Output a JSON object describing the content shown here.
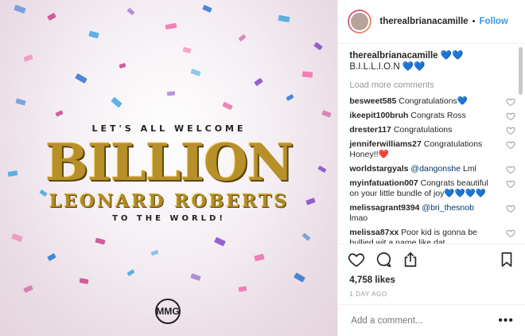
{
  "post": {
    "image": {
      "line_top": "LET'S ALL WELCOME",
      "line_big": "BILLION",
      "line_name": "LEONARD ROBERTS",
      "line_bottom": "TO THE WORLD!",
      "logo_text": "MMG"
    }
  },
  "header": {
    "username": "therealbrianacamille",
    "dot": "•",
    "follow_label": "Follow"
  },
  "caption": {
    "username": "therealbrianacamille",
    "text": " 💙💙 B.I.L.L.I.O.N 💙💙"
  },
  "load_more_label": "Load more comments",
  "comments": [
    {
      "user": "besweet585",
      "text": " Congratulations💙"
    },
    {
      "user": "ikeepit100bruh",
      "text": " Congrats Ross"
    },
    {
      "user": "drester117",
      "text": " Congratulations"
    },
    {
      "user": "jenniferwilliams27",
      "text": " Congratulations Honey!!❤️"
    },
    {
      "user": "worldstargyals",
      "mention": "@dangonshe",
      "text": " Lml"
    },
    {
      "user": "myinfatuation007",
      "text": " Congrats beautiful on your little bundle of joy💙💙💙💙"
    },
    {
      "user": "melissagrant9394",
      "mention": "@bri_thesnob",
      "text": " lmao"
    },
    {
      "user": "melissa87xx",
      "text": " Poor kid is gonna be bullied wit a name like dat"
    }
  ],
  "likes_text": "4,758 likes",
  "time_text": "1 DAY AGO",
  "add_comment": {
    "placeholder": "Add a comment...",
    "more_label": "•••"
  },
  "colors": {
    "accent": "#3897f0",
    "confetti": [
      "#1e6fd0",
      "#c33b86",
      "#3aa0e0",
      "#7c3fc4",
      "#f067a6"
    ]
  }
}
